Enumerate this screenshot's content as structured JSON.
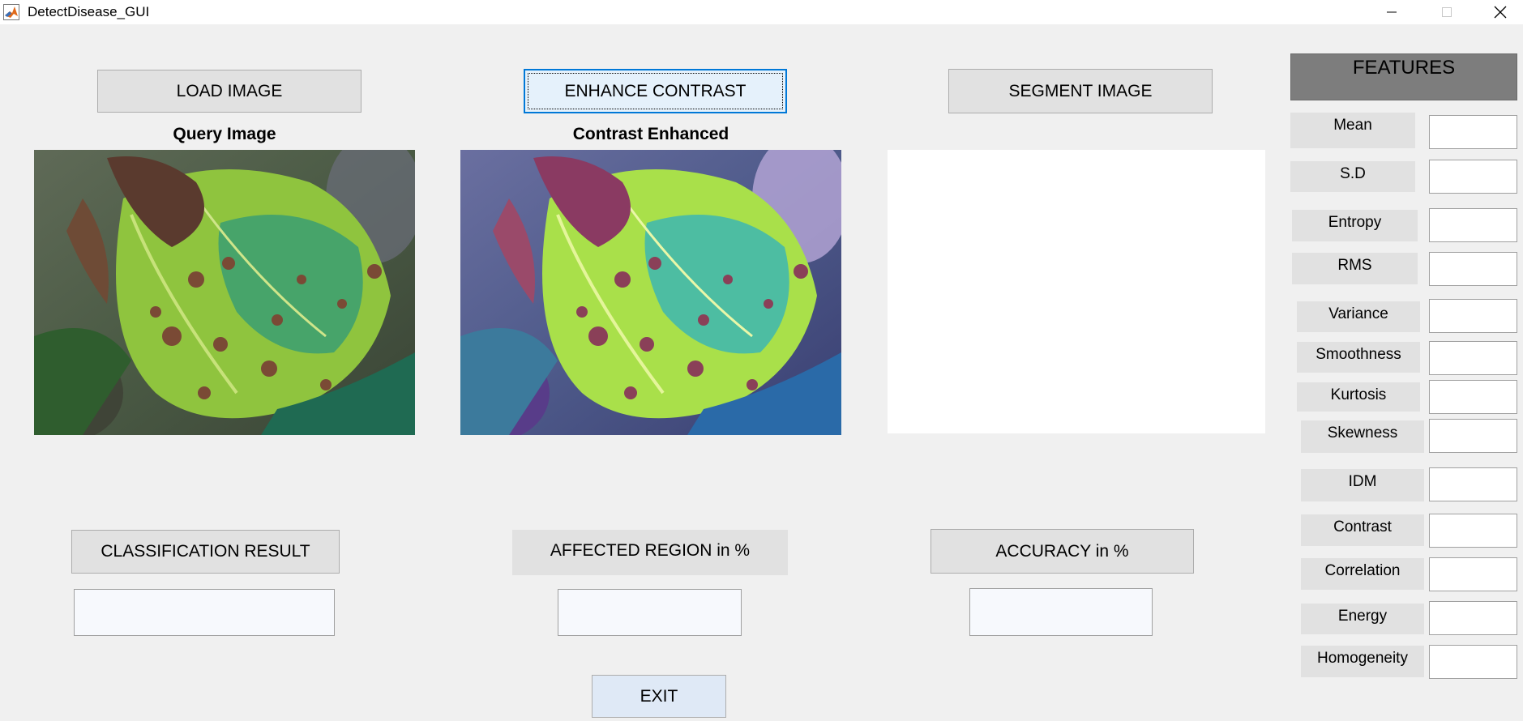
{
  "window": {
    "title": "DetectDisease_GUI"
  },
  "buttons": {
    "load": "LOAD IMAGE",
    "enhance": "ENHANCE CONTRAST",
    "segment": "SEGMENT IMAGE",
    "classification": "CLASSIFICATION RESULT",
    "accuracy": "ACCURACY in %",
    "exit": "EXIT"
  },
  "labels": {
    "affected_region": "AFFECTED REGION in %"
  },
  "axes": {
    "query_title": "Query Image",
    "enhanced_title": "Contrast Enhanced"
  },
  "results": {
    "classification": "",
    "affected_region": "",
    "accuracy": ""
  },
  "features": {
    "header": "FEATURES",
    "items": [
      {
        "label": "Mean",
        "value": ""
      },
      {
        "label": "S.D",
        "value": ""
      },
      {
        "label": "Entropy",
        "value": ""
      },
      {
        "label": "RMS",
        "value": ""
      },
      {
        "label": "Variance",
        "value": ""
      },
      {
        "label": "Smoothness",
        "value": ""
      },
      {
        "label": "Kurtosis",
        "value": ""
      },
      {
        "label": "Skewness",
        "value": ""
      },
      {
        "label": "IDM",
        "value": ""
      },
      {
        "label": "Contrast",
        "value": ""
      },
      {
        "label": "Correlation",
        "value": ""
      },
      {
        "label": "Energy",
        "value": ""
      },
      {
        "label": "Homogeneity",
        "value": ""
      }
    ]
  },
  "icons": {
    "app": "matlab-icon",
    "minimize": "minimize-icon",
    "maximize": "maximize-icon",
    "close": "close-icon"
  }
}
